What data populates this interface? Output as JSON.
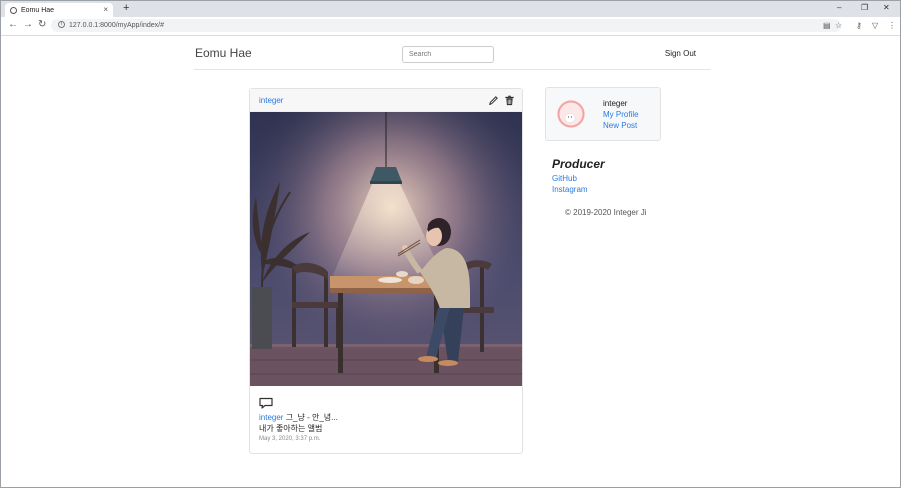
{
  "browser": {
    "tab_title": "Eomu Hae",
    "tab_close": "×",
    "new_tab": "+",
    "url": "127.0.0.1:8000/myApp/index/#",
    "minimize": "–",
    "restore": "❐",
    "close": "✕"
  },
  "navbar": {
    "brand": "Eomu Hae",
    "search_placeholder": "Search",
    "sign_out": "Sign Out"
  },
  "post": {
    "username": "integer",
    "caption_user": "integer",
    "caption_text": " 그_냥 - 안_녕...",
    "caption_line2": "내가 좋아하는 앨범",
    "timestamp": "May 3, 2020, 3:37 p.m."
  },
  "profile": {
    "name": "integer",
    "my_profile": "My Profile",
    "new_post": "New Post"
  },
  "sidebar": {
    "producer_heading": "Producer",
    "github": "GitHub",
    "instagram": "Instagram",
    "copyright": "© 2019-2020 Integer Ji"
  },
  "colors": {
    "link": "#2a7ae2"
  }
}
